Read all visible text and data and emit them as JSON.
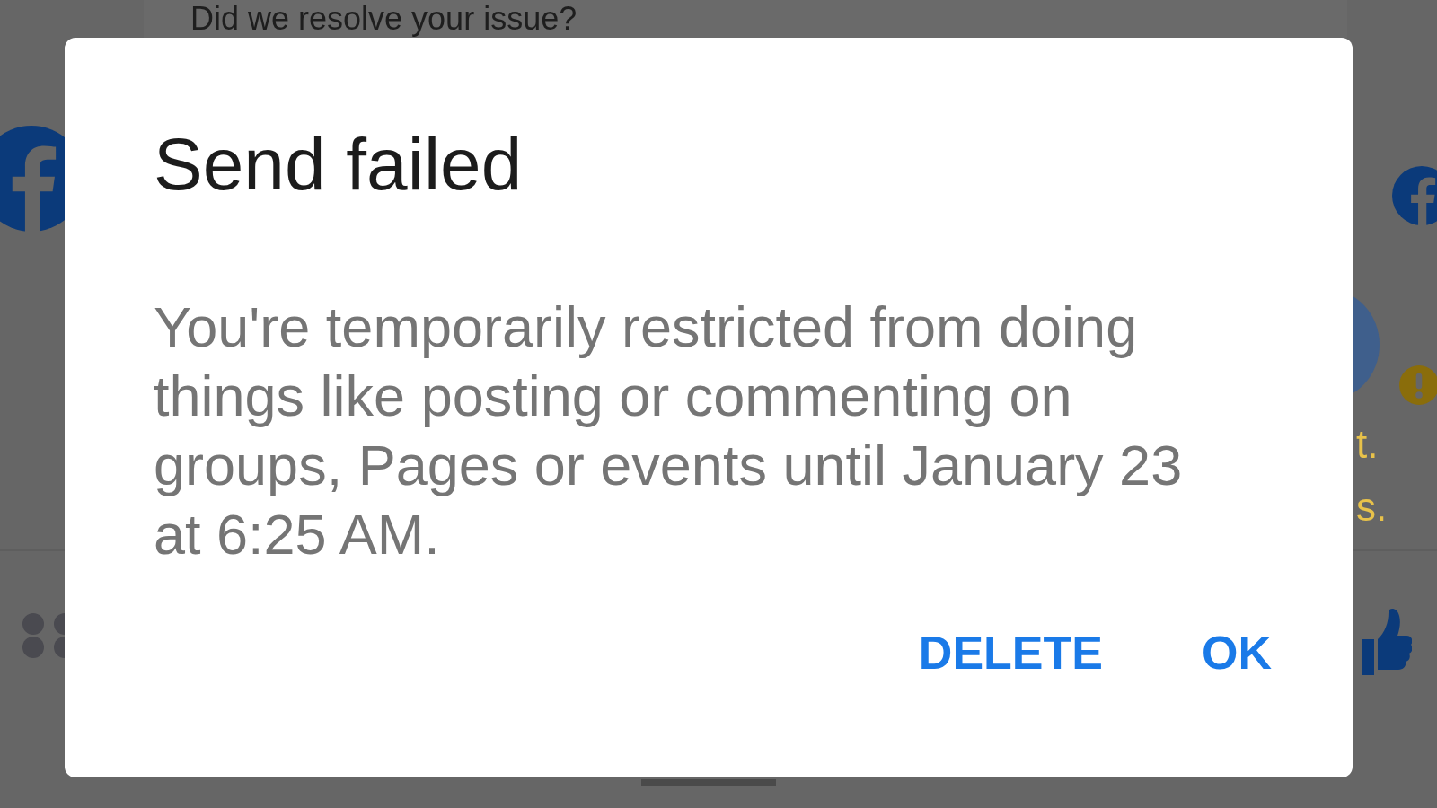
{
  "background": {
    "heading": "Did we resolve your issue?",
    "fragments": [
      "t.",
      "s."
    ]
  },
  "dialog": {
    "title": "Send failed",
    "message": "You're temporarily restricted from doing things like posting or commenting on groups, Pages or events until January 23 at 6:25 AM.",
    "buttons": [
      "DELETE",
      "OK"
    ]
  }
}
